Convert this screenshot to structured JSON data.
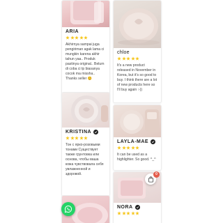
{
  "colors": {
    "star": "#f5c518",
    "verified_bg": "#1f1f1f",
    "whatsapp": "#25d366",
    "badge": "#e45c4b"
  },
  "reviews": [
    {
      "name": "ARIA",
      "verified": true,
      "rating": 5,
      "text": "Akhirnya sampai juga pengiriman agak lama ci mungkin karena akhir tahun yaa.. Produk pastinya original.. Belum di coba ci tp biasanya cocok ma missha.. Thanks seller 😊"
    },
    {
      "name": "chloe",
      "verified": false,
      "rating": 5,
      "text": "It's a new product released in November in Korea, but it's so good to buy. I think there are a lot of new products here so I'll buy again :-))"
    },
    {
      "name": "KRISTINA",
      "verified": true,
      "rating": 5,
      "text": "Тон с ярко-розовыми тонами Существует также грунтовка или основа, чтобы ваша кожа чувствовала себя увлажненной и здоровой."
    },
    {
      "name": "LAYLA-MAE",
      "verified": true,
      "rating": 5,
      "text": "It can be used as a highlighter. So good. ^_^"
    },
    {
      "name": "NORA",
      "verified": true,
      "rating": 5,
      "text": ""
    }
  ],
  "cart": {
    "count": "0"
  },
  "icons": {
    "whatsapp": "whatsapp-icon",
    "bag": "shopping-bag-icon",
    "star": "star-icon",
    "verified": "verified-check-icon"
  }
}
